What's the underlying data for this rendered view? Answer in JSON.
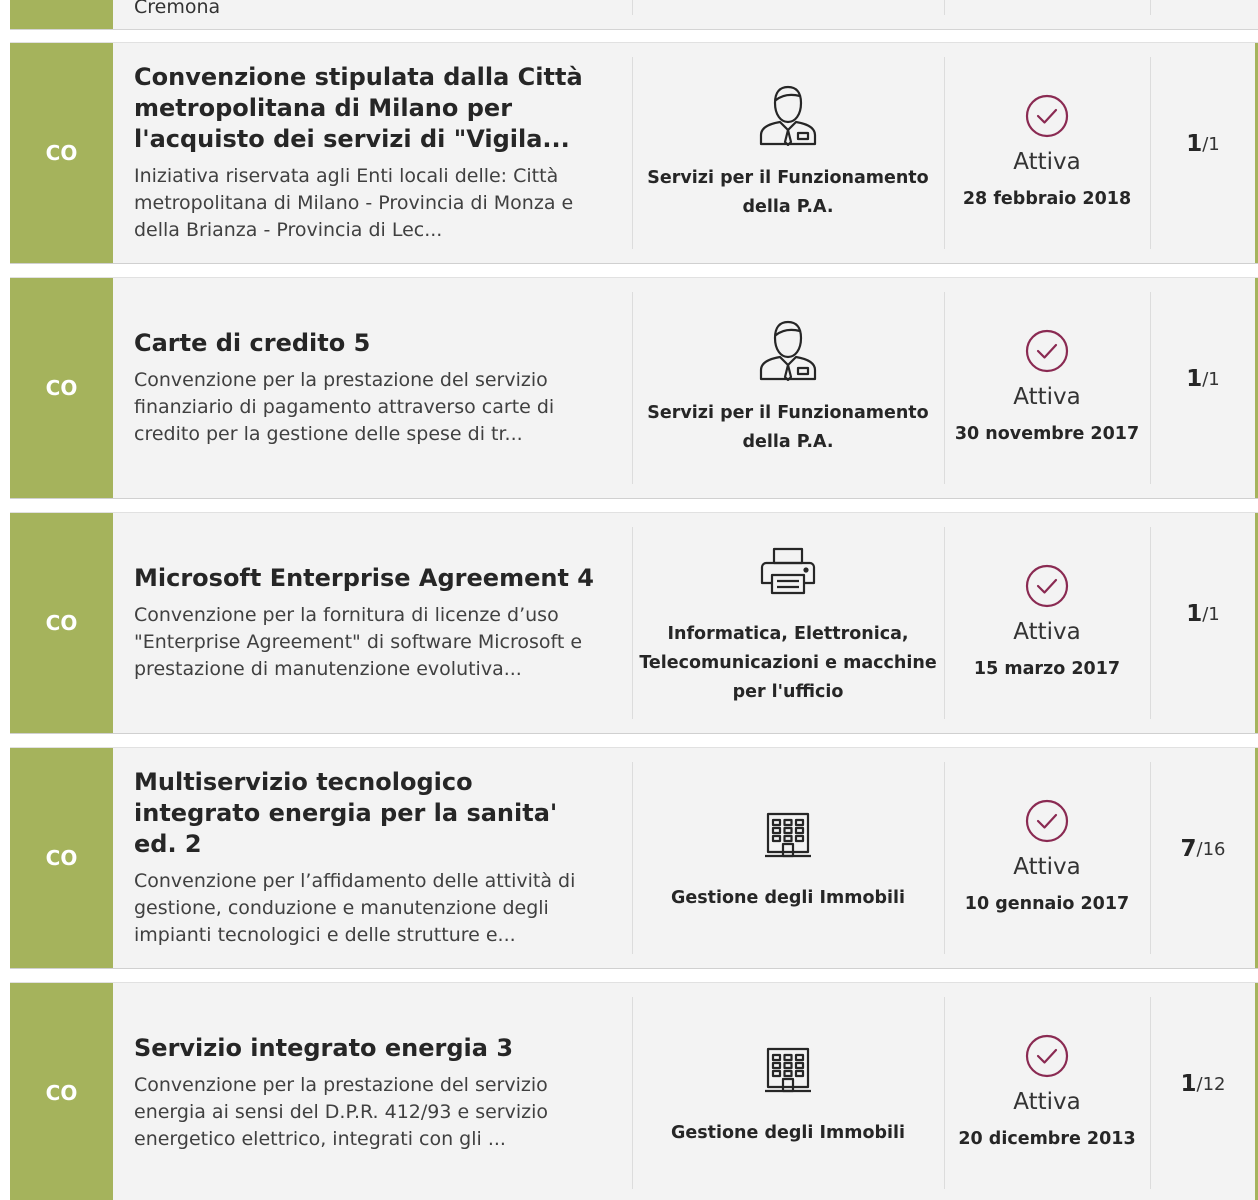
{
  "partial": {
    "text": "Cremona"
  },
  "rows": [
    {
      "badge": "CO",
      "title": "Convenzione stipulata dalla Città metropolitana di Milano per l'acquisto dei servizi di \"Vigila...",
      "description": "Iniziativa riservata agli Enti locali delle: Città metropolitana di Milano - Provincia di Monza e della Brianza - Provincia di Lec...",
      "category_icon": "person-icon",
      "category": "Servizi per il Funzionamento della P.A.",
      "status": "Attiva",
      "date": "28 febbraio 2018",
      "count_current": "1",
      "count_total": "/1"
    },
    {
      "badge": "CO",
      "title": "Carte di credito 5",
      "description": "Convenzione per la prestazione del servizio finanziario di pagamento attraverso carte di credito per la gestione delle spese di tr...",
      "category_icon": "person-icon",
      "category": "Servizi per il Funzionamento della P.A.",
      "status": "Attiva",
      "date": "30 novembre 2017",
      "count_current": "1",
      "count_total": "/1"
    },
    {
      "badge": "CO",
      "title": "Microsoft Enterprise Agreement 4",
      "description": "Convenzione per la fornitura di licenze d’uso \"Enterprise Agreement\" di software Microsoft e prestazione di manutenzione evolutiva...",
      "category_icon": "printer-icon",
      "category": "Informatica, Elettronica, Telecomunicazioni e macchine per l'ufficio",
      "status": "Attiva",
      "date": "15 marzo 2017",
      "count_current": "1",
      "count_total": "/1"
    },
    {
      "badge": "CO",
      "title": "Multiservizio tecnologico integrato energia per la sanita' ed. 2",
      "description": "Convenzione per l’affidamento delle attività di gestione, conduzione e manutenzione degli impianti tecnologici e delle strutture e...",
      "category_icon": "building-icon",
      "category": "Gestione degli Immobili",
      "status": "Attiva",
      "date": "10 gennaio 2017",
      "count_current": "7",
      "count_total": "/16"
    },
    {
      "badge": "CO",
      "title": "Servizio integrato energia 3",
      "description": "Convenzione per la prestazione del servizio energia ai sensi del D.P.R. 412/93 e servizio energetico elettrico, integrati con gli ...",
      "category_icon": "building-icon",
      "category": "Gestione degli Immobili",
      "status": "Attiva",
      "date": "20 dicembre 2013",
      "count_current": "1",
      "count_total": "/12"
    }
  ],
  "colors": {
    "badge": "#a5b35c",
    "check": "#8a2a52"
  }
}
